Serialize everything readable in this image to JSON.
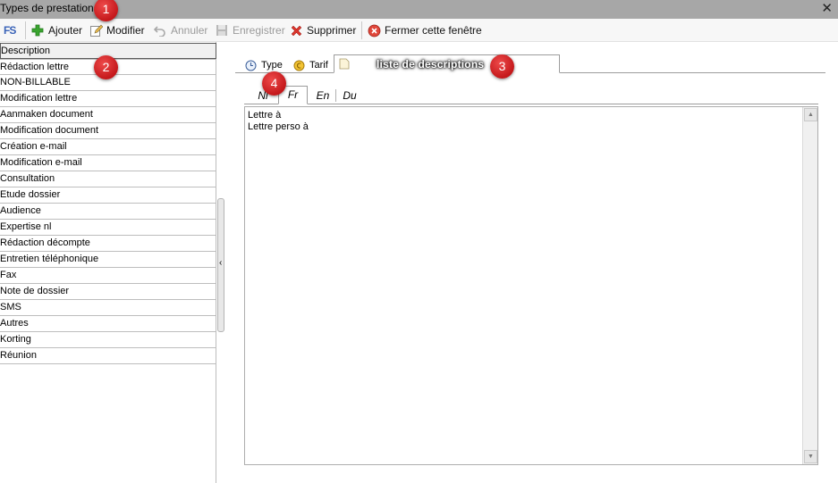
{
  "window": {
    "title": "Types de prestations",
    "close_glyph": "✕"
  },
  "toolbar": {
    "logo_text": "FS",
    "buttons": [
      {
        "id": "add",
        "label": "Ajouter",
        "icon": "plus-icon",
        "enabled": true
      },
      {
        "id": "edit",
        "label": "Modifier",
        "icon": "edit-icon",
        "enabled": true
      },
      {
        "id": "undo",
        "label": "Annuler",
        "icon": "undo-icon",
        "enabled": false
      },
      {
        "id": "save",
        "label": "Enregistrer",
        "icon": "save-icon",
        "enabled": false
      },
      {
        "id": "delete",
        "label": "Supprimer",
        "icon": "delete-icon",
        "enabled": true
      },
      {
        "id": "close",
        "label": "Fermer cette fenêtre",
        "icon": "close-circle-icon",
        "enabled": true
      }
    ]
  },
  "list": {
    "header": "Description",
    "items": [
      "Rédaction lettre",
      "NON-BILLABLE",
      "Modification lettre",
      "Aanmaken document",
      "Modification document",
      "Création e-mail",
      "Modification e-mail",
      "Consultation",
      "Etude dossier",
      "Audience",
      "Expertise nl",
      "Rédaction décompte",
      "Entretien téléphonique",
      "Fax",
      "Note de dossier",
      "SMS",
      "Autres",
      "Korting",
      "Réunion"
    ]
  },
  "tabs": {
    "type_label": "Type",
    "tarif_label": "Tarif",
    "descriptions_label": "liste de descriptions",
    "active": "descriptions"
  },
  "lang_tabs": {
    "items": [
      "Nl",
      "Fr",
      "En",
      "Du"
    ],
    "active": "Fr"
  },
  "editor": {
    "lines": [
      "Lettre à",
      "Lettre perso à"
    ]
  },
  "annotations": [
    "1",
    "2",
    "3",
    "4"
  ],
  "colors": {
    "titlebar": "#a7a7a7",
    "badge": "#d42022",
    "add_green": "#3aa42f",
    "delete_red": "#d9342b"
  }
}
